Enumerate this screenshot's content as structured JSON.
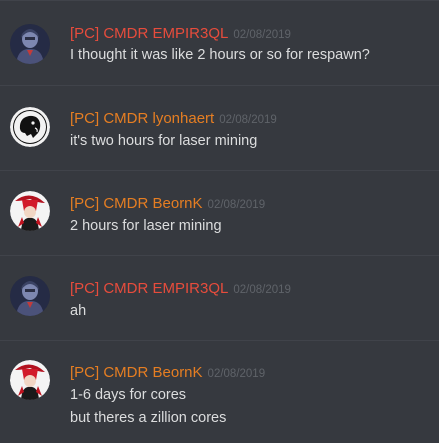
{
  "colors": {
    "background": "#36393f",
    "divider": "#40434a",
    "message_text": "#dcddde",
    "timestamp": "#5f6369",
    "role_red": "#e74c3c",
    "role_orange": "#e67e22"
  },
  "messages": [
    {
      "author": "[PC] CMDR EMPIR3QL",
      "author_color": "#e74c3c",
      "avatar_icon": "dark-portrait-avatar-icon",
      "timestamp": "02/08/2019",
      "lines": [
        "I thought it was like 2 hours or so for respawn?"
      ]
    },
    {
      "author": "[PC] CMDR lyonhaert",
      "author_color": "#e67e22",
      "avatar_icon": "lion-emblem-avatar-icon",
      "timestamp": "02/08/2019",
      "lines": [
        "it's two hours for laser mining"
      ]
    },
    {
      "author": "[PC] CMDR BeornK",
      "author_color": "#e67e22",
      "avatar_icon": "red-hat-character-avatar-icon",
      "timestamp": "02/08/2019",
      "lines": [
        "2 hours for laser mining"
      ]
    },
    {
      "author": "[PC] CMDR EMPIR3QL",
      "author_color": "#e74c3c",
      "avatar_icon": "dark-portrait-avatar-icon",
      "timestamp": "02/08/2019",
      "lines": [
        "ah"
      ]
    },
    {
      "author": "[PC] CMDR BeornK",
      "author_color": "#e67e22",
      "avatar_icon": "red-hat-character-avatar-icon",
      "timestamp": "02/08/2019",
      "lines": [
        "1-6 days for cores",
        "but theres a zillion cores"
      ]
    }
  ]
}
